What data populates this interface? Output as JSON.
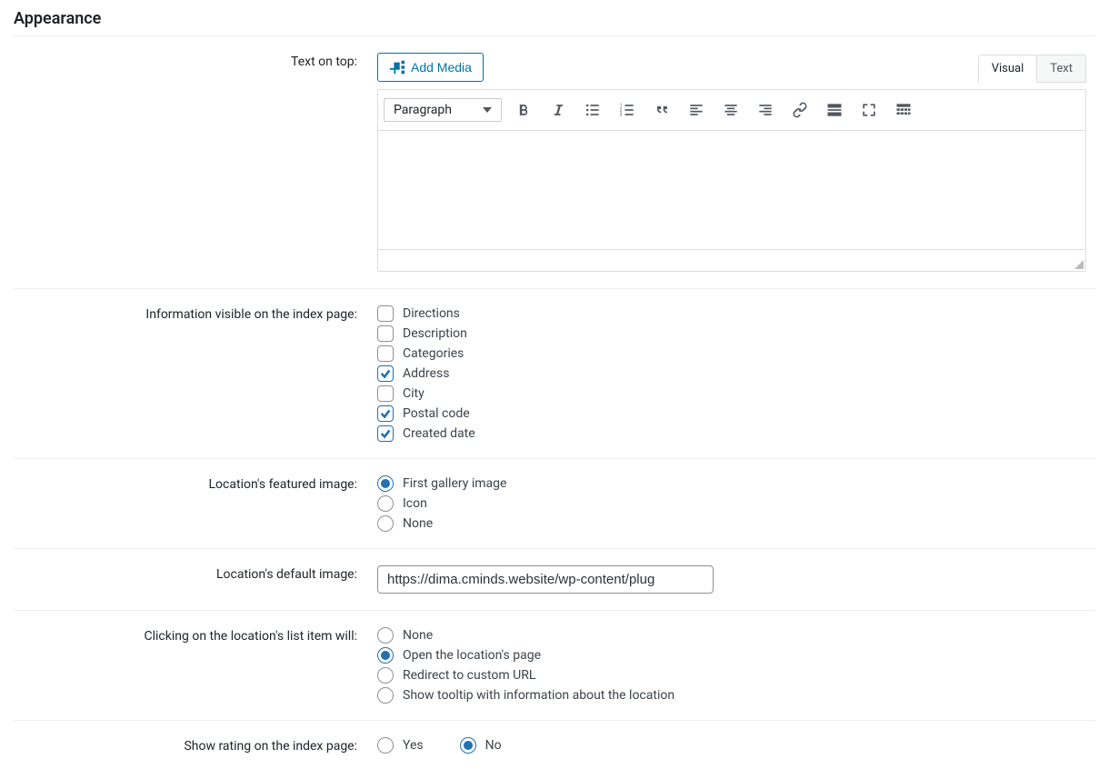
{
  "section_title": "Appearance",
  "fields": {
    "text_on_top": {
      "label": "Text on top:",
      "add_media": "Add Media",
      "tabs": {
        "visual": "Visual",
        "text": "Text"
      },
      "format_selected": "Paragraph"
    },
    "info_visible": {
      "label": "Information visible on the index page:",
      "options": [
        {
          "label": "Directions",
          "checked": false
        },
        {
          "label": "Description",
          "checked": false
        },
        {
          "label": "Categories",
          "checked": false
        },
        {
          "label": "Address",
          "checked": true
        },
        {
          "label": "City",
          "checked": false
        },
        {
          "label": "Postal code",
          "checked": true
        },
        {
          "label": "Created date",
          "checked": true
        }
      ]
    },
    "featured_image": {
      "label": "Location's featured image:",
      "options": [
        {
          "label": "First gallery image",
          "checked": true
        },
        {
          "label": "Icon",
          "checked": false
        },
        {
          "label": "None",
          "checked": false
        }
      ]
    },
    "default_image": {
      "label": "Location's default image:",
      "value": "https://dima.cminds.website/wp-content/plug"
    },
    "click_action": {
      "label": "Clicking on the location's list item will:",
      "options": [
        {
          "label": "None",
          "checked": false
        },
        {
          "label": "Open the location's page",
          "checked": true
        },
        {
          "label": "Redirect to custom URL",
          "checked": false
        },
        {
          "label": "Show tooltip with information about the location",
          "checked": false
        }
      ]
    },
    "show_rating": {
      "label": "Show rating on the index page:",
      "options": [
        {
          "label": "Yes",
          "checked": false
        },
        {
          "label": "No",
          "checked": true
        }
      ]
    }
  }
}
